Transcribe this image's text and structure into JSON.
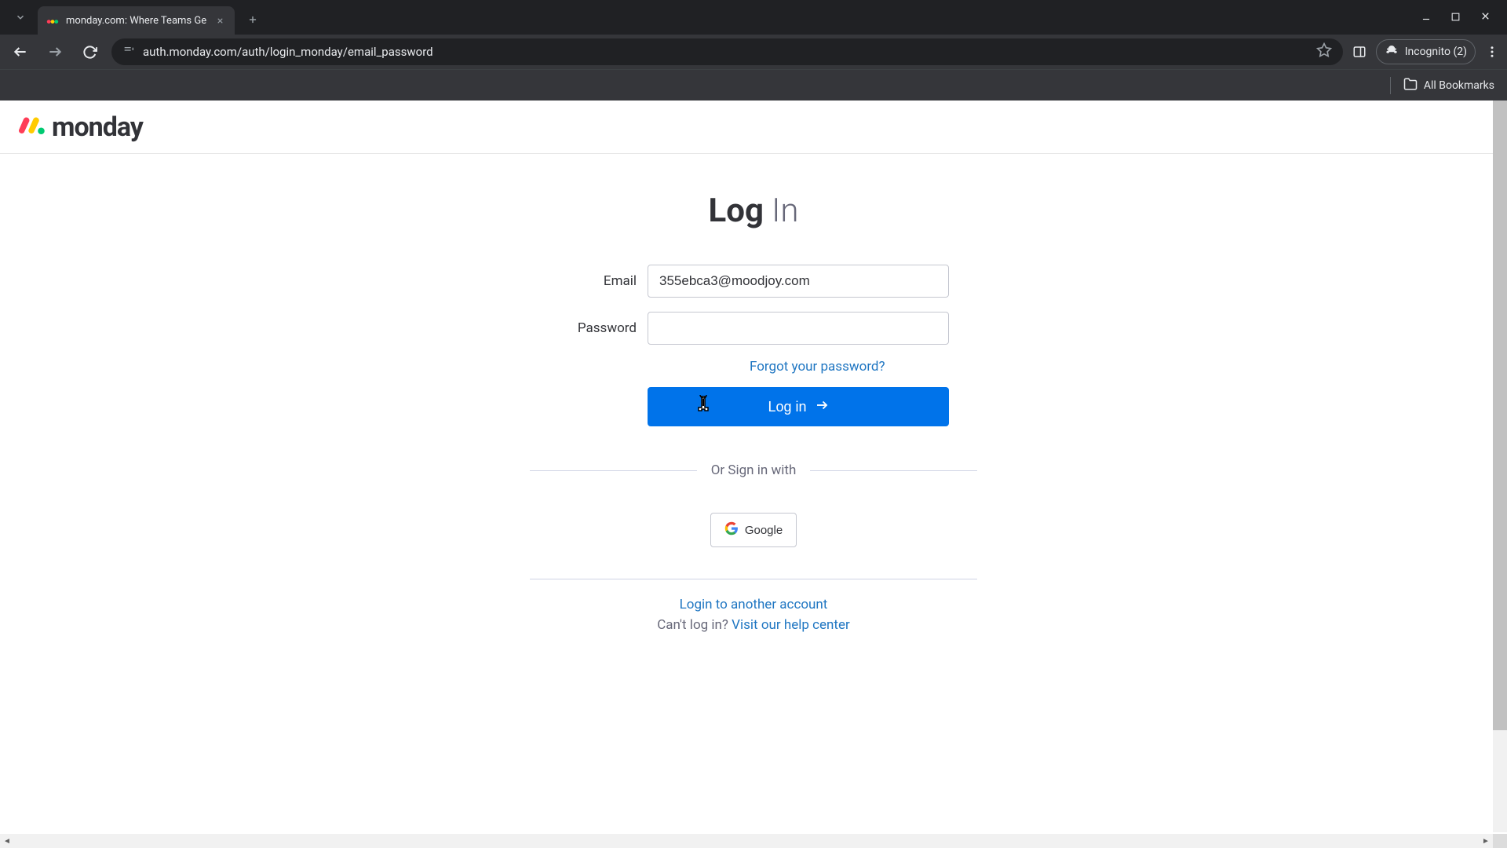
{
  "browser": {
    "tab_title": "monday.com: Where Teams Ge",
    "url": "auth.monday.com/auth/login_monday/email_password",
    "incognito_label": "Incognito (2)",
    "all_bookmarks": "All Bookmarks"
  },
  "header": {
    "logo_text": "monday"
  },
  "login": {
    "title_bold": "Log",
    "title_light": " In",
    "email_label": "Email",
    "email_value": "355ebca3@moodjoy.com",
    "password_label": "Password",
    "password_value": "",
    "forgot_link": "Forgot your password?",
    "login_button": "Log in",
    "divider_text": "Or Sign in with",
    "google_button": "Google"
  },
  "footer": {
    "another_account": "Login to another account",
    "cant_login": "Can't log in? ",
    "help_center": "Visit our help center"
  }
}
